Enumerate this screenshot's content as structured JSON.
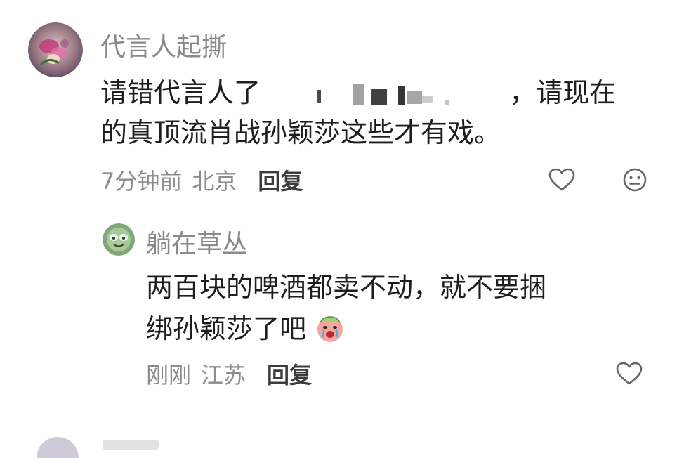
{
  "comments": [
    {
      "username": "代言人起撕",
      "text_part1": "请错代言人了",
      "text_part2": "，请现在",
      "text_line2": "的真顶流肖战孙颖莎这些才有戏。",
      "time": "7分钟前",
      "location": "北京",
      "reply_label": "回复",
      "like_icon": "heart-outline-icon",
      "dislike_icon": "face-neutral-icon",
      "avatar_icon": "avatar-flower-icon"
    }
  ],
  "reply": {
    "username": "躺在草丛",
    "text_line1": "两百块的啤酒都卖不动，就不要捆",
    "text_line2": "绑孙颖莎了吧",
    "time": "刚刚",
    "location": "江苏",
    "reply_label": "回复",
    "like_icon": "heart-outline-icon",
    "avatar_icon": "avatar-green-icon",
    "emoji_icon": "crying-face-emoji-icon"
  },
  "colors": {
    "username": "#8a8a8a",
    "body_text": "#1e1e1e",
    "meta_text": "#8c8c8c",
    "reply_label": "#3c3c3c"
  }
}
